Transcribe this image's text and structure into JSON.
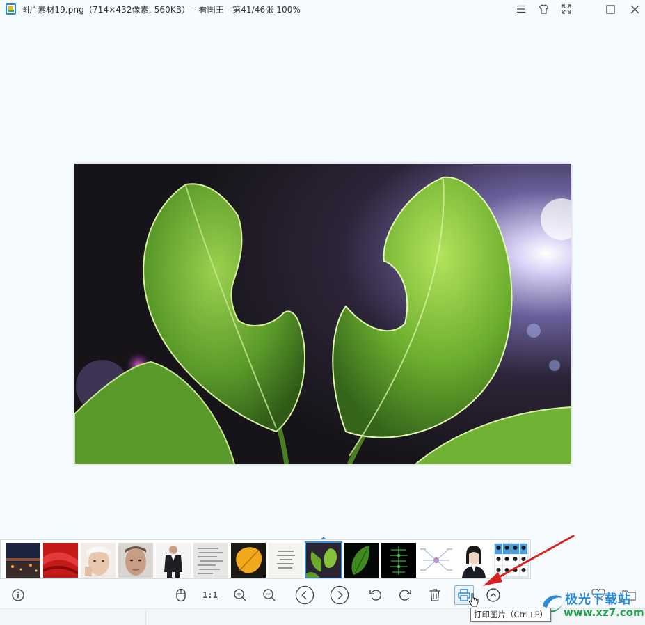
{
  "window": {
    "title": "图片素材19.png（714×432像素, 560KB） - 看图王 - 第41/46张 100%",
    "buttons": [
      "menu-icon",
      "skin-icon",
      "fullscreen-icon",
      "maximize-icon",
      "close-icon"
    ]
  },
  "viewer": {
    "image_description_icon": "leaf-photo",
    "selected_thumbnail_index": 8
  },
  "thumbnails": [
    {
      "name": "city-night",
      "bg": "#1c2440"
    },
    {
      "name": "red-fabric",
      "bg": "#c41a1a"
    },
    {
      "name": "woman-face",
      "bg": "#e9d9cc"
    },
    {
      "name": "man-face",
      "bg": "#c9b6a6"
    },
    {
      "name": "suit-man",
      "bg": "#f0f0f0"
    },
    {
      "name": "handwriting",
      "bg": "#ececec"
    },
    {
      "name": "yellow-leaf",
      "bg": "#1b1a12"
    },
    {
      "name": "handwriting-2",
      "bg": "#f3f3f0"
    },
    {
      "name": "green-leaves",
      "bg": "#2b2431"
    },
    {
      "name": "dark-leaf",
      "bg": "#050805"
    },
    {
      "name": "circuit-diagram",
      "bg": "#000000"
    },
    {
      "name": "mind-map",
      "bg": "#ffffff"
    },
    {
      "name": "id-photo",
      "bg": "#ffffff"
    },
    {
      "name": "id-photo-grid",
      "bg": "#dfe8f2"
    }
  ],
  "toolbar": {
    "info": "info-icon",
    "mouse": "mouse-icon",
    "actual_size_label": "1:1",
    "zoom_in": "zoom-in-icon",
    "zoom_out": "zoom-out-icon",
    "prev": "chevron-left-icon",
    "next": "chevron-right-icon",
    "rotate_left": "rotate-left-icon",
    "rotate_right": "rotate-right-icon",
    "delete": "trash-icon",
    "print": "printer-icon",
    "more": "chevron-up-icon"
  },
  "tooltip": {
    "text": "打印图片（Ctrl+P）"
  },
  "watermark": {
    "title": "极光下载站",
    "url": "www.xz7.com"
  },
  "colors": {
    "background": "#f5fbfe",
    "accent": "#3b8fd6",
    "arrow": "#d8221e"
  }
}
